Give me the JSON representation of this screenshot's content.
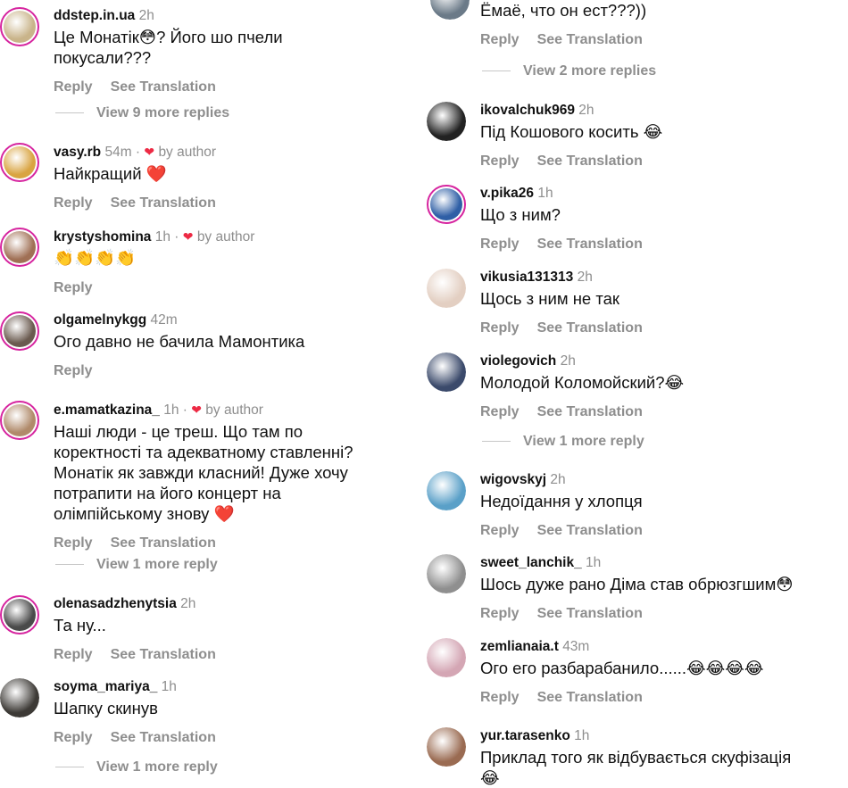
{
  "ui": {
    "reply": "Reply",
    "see_translation": "See Translation",
    "dot": " · ",
    "heart": "❤",
    "by_author": "by author"
  },
  "left": [
    {
      "username": "ddstep.in.ua",
      "time": "2h",
      "text": "Це Монатік😳? Його шо пчели\nпокусали???",
      "translation": true,
      "more": "View 9 more replies",
      "avatar": "#c9b48a"
    },
    {
      "username": "vasy.rb",
      "time": "54m",
      "byauthor": true,
      "text": "Найкращий ❤️",
      "translation": true,
      "avatar": "#d9a441"
    },
    {
      "username": "krystyshomina",
      "time": "1h",
      "byauthor": true,
      "text": "👏👏👏👏",
      "translation": false,
      "avatar": "#a07055"
    },
    {
      "username": "olgamelnykgg",
      "time": "42m",
      "text": "Ого давно не бачила Мамонтика",
      "translation": false,
      "avatar": "#6a5a4f"
    },
    {
      "username": "e.mamatkazina_",
      "time": "1h",
      "byauthor": true,
      "text": "Наші люди - це треш. Що там по\nкоректності та адекватному ставленні?\nМонатік як завжди класний! Дуже хочу\nпотрапити на його концерт на\nолімпійському знову ❤️",
      "translation": true,
      "more": "View 1 more reply",
      "avatar": "#b08a6a"
    },
    {
      "username": "olenasadzhenytsia",
      "time": "2h",
      "text": "Та ну...",
      "translation": true,
      "avatar": "#4a4a4a"
    },
    {
      "username": "soyma_mariya_",
      "time": "1h",
      "text": "Шапку скинув",
      "translation": true,
      "more": "View 1 more reply",
      "avatar": "#3d3a36"
    }
  ],
  "right": [
    {
      "username": "",
      "time": "",
      "text": "Ёмаё,  что он ест???))",
      "translation": true,
      "more": "View 2 more replies",
      "avatar": "#6b7a88"
    },
    {
      "username": "ikovalchuk969",
      "time": "2h",
      "text": "Під Кошового косить 😂",
      "translation": true,
      "avatar": "#222222"
    },
    {
      "username": "v.pika26",
      "time": "1h",
      "text": "Що з ним?",
      "translation": true,
      "avatar": "#2f5fa6"
    },
    {
      "username": "vikusia131313",
      "time": "2h",
      "text": "Щось з ним не так",
      "translation": true,
      "avatar": "#e3cfc2"
    },
    {
      "username": "violegovich",
      "time": "2h",
      "text": "Молодой Коломойский?😂",
      "translation": true,
      "more": "View 1 more reply",
      "avatar": "#3b4a6b"
    },
    {
      "username": "wigovskyj",
      "time": "2h",
      "text": "Недоїдання у хлопця",
      "translation": true,
      "avatar": "#5aa0c8"
    },
    {
      "username": "sweet_lanchik_",
      "time": "1h",
      "text": "Шось дуже рано Діма став обрюзгшим😳",
      "translation": true,
      "avatar": "#8f8f8f"
    },
    {
      "username": "zemlianaia.t",
      "time": "43m",
      "text": "Ого его разбарабанило......😂😂😂😂",
      "translation": true,
      "avatar": "#d4a6b4"
    },
    {
      "username": "yur.tarasenko",
      "time": "1h",
      "text": "Приклад того як відбувається скуфізація\n😂",
      "translation": false,
      "avatar": "#9a6b52"
    }
  ]
}
